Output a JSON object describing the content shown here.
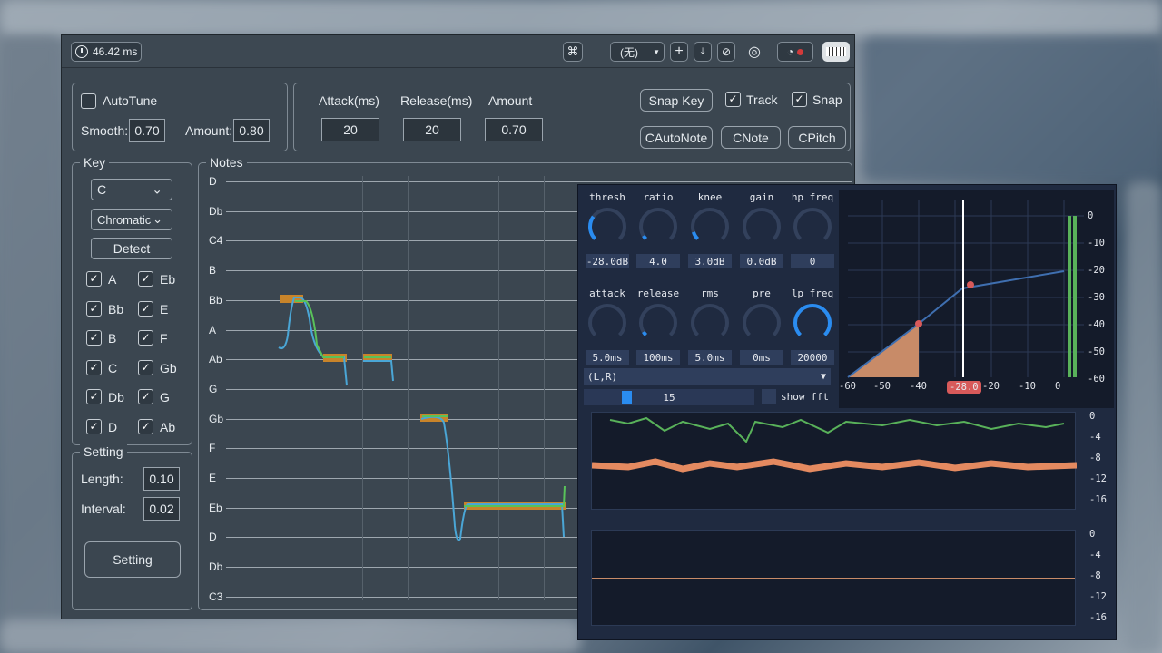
{
  "titlebar": {
    "latency": "46.42 ms",
    "preset_value": "(无)"
  },
  "autotune": {
    "enabled_label": "AutoTune",
    "smooth_label": "Smooth:",
    "smooth_value": "0.70",
    "amount_label": "Amount:",
    "amount_value": "0.80"
  },
  "envelope": {
    "attack_label": "Attack(ms)",
    "attack_value": "20",
    "release_label": "Release(ms)",
    "release_value": "20",
    "amount_label": "Amount",
    "amount_value": "0.70"
  },
  "actions": {
    "snap_key": "Snap Key",
    "track": "Track",
    "snap": "Snap",
    "cautonote": "CAutoNote",
    "cnote": "CNote",
    "cpitch": "CPitch"
  },
  "key": {
    "title": "Key",
    "key_value": "C",
    "scale_value": "Chromatic",
    "detect": "Detect",
    "notes_left": [
      "A",
      "Bb",
      "B",
      "C",
      "Db",
      "D"
    ],
    "notes_right": [
      "Eb",
      "E",
      "F",
      "Gb",
      "G",
      "Ab"
    ]
  },
  "setting": {
    "title": "Setting",
    "length_label": "Length:",
    "length_value": "0.10",
    "interval_label": "Interval:",
    "interval_value": "0.02",
    "button": "Setting"
  },
  "notes": {
    "title": "Notes",
    "labels": [
      "D",
      "Db",
      "C4",
      "B",
      "Bb",
      "A",
      "Ab",
      "G",
      "Gb",
      "F",
      "E",
      "Eb",
      "D",
      "Db",
      "C3"
    ]
  },
  "compressor": {
    "knobs_row1": [
      {
        "label": "thresh",
        "value": "-28.0dB"
      },
      {
        "label": "ratio",
        "value": "4.0"
      },
      {
        "label": "knee",
        "value": "3.0dB"
      },
      {
        "label": "gain",
        "value": "0.0dB"
      },
      {
        "label": "hp freq",
        "value": "0"
      }
    ],
    "knobs_row2": [
      {
        "label": "attack",
        "value": "5.0ms"
      },
      {
        "label": "release",
        "value": "100ms"
      },
      {
        "label": "rms",
        "value": "5.0ms"
      },
      {
        "label": "pre",
        "value": "0ms"
      },
      {
        "label": "lp freq",
        "value": "20000"
      }
    ],
    "knob_levels_row1": [
      0.3,
      0.05,
      0.1,
      0.0,
      0.0
    ],
    "knob_levels_row2": [
      0.0,
      0.05,
      0.0,
      0.0,
      1.0
    ],
    "channel_select": "(L,R)",
    "slider_value": "15",
    "show_fft": "show fft",
    "curve_x_labels": [
      "-60",
      "-50",
      "-40",
      "-28.0",
      "-20",
      "-10",
      "0"
    ],
    "curve_y_labels": [
      "0",
      "-10",
      "-20",
      "-30",
      "-40",
      "-50",
      "-60"
    ],
    "scope_y_labels": [
      "0",
      "-4",
      "-8",
      "-12",
      "-16"
    ],
    "accent": "#2a8cf0",
    "marker_color": "#d85a5a"
  }
}
